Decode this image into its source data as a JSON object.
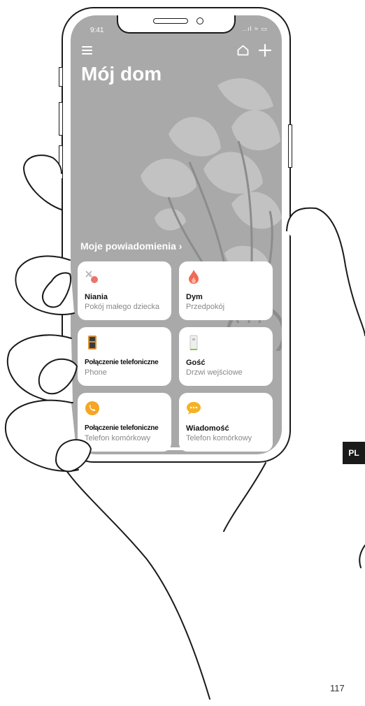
{
  "status_bar": {
    "time": "9:41",
    "icons": "..ıl ≈ ▭"
  },
  "header": {
    "menu_icon": "hamburger-menu-icon",
    "home_icon": "home-icon",
    "add_icon": "plus-icon"
  },
  "page_title": "Mój dom",
  "notifications": {
    "section_title": "Moje powiadomienia ›",
    "cards": [
      {
        "title": "Niania",
        "subtitle": "Pokój małego dziecka",
        "icon": "baby-monitor-icon",
        "color": "#e8756a"
      },
      {
        "title": "Dym",
        "subtitle": "Przedpokój",
        "icon": "flame-icon",
        "color": "#f06a55"
      },
      {
        "title": "Połączenie telefoniczne",
        "subtitle": "Phone",
        "icon": "desk-phone-icon",
        "color": "#d99030"
      },
      {
        "title": "Gość",
        "subtitle": "Drzwi wejściowe",
        "icon": "door-station-icon",
        "color": "#e6e6e6"
      },
      {
        "title": "Połączenie telefoniczne",
        "subtitle": "Telefon komórkowy",
        "icon": "phone-call-icon",
        "color": "#f5a623"
      },
      {
        "title": "Wiadomość",
        "subtitle": "Telefon komórkowy",
        "icon": "message-bubble-icon",
        "color": "#f5b223"
      }
    ]
  },
  "language_badge": "PL",
  "page_number": "117"
}
